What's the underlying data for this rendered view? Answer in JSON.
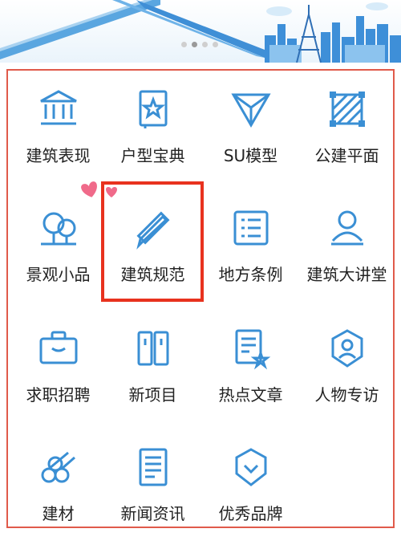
{
  "banner": {
    "pages": 4,
    "active_page": 1
  },
  "grid": [
    {
      "label": "建筑表现",
      "icon": "bank-icon"
    },
    {
      "label": "户型宝典",
      "icon": "star-book-icon"
    },
    {
      "label": "SU模型",
      "icon": "triangle-model-icon"
    },
    {
      "label": "公建平面",
      "icon": "hatched-square-icon"
    },
    {
      "label": "景观小品",
      "icon": "trees-icon"
    },
    {
      "label": "建筑规范",
      "icon": "ruler-pencil-icon"
    },
    {
      "label": "地方条例",
      "icon": "list-icon"
    },
    {
      "label": "建筑大讲堂",
      "icon": "person-icon"
    },
    {
      "label": "求职招聘",
      "icon": "briefcase-icon"
    },
    {
      "label": "新项目",
      "icon": "binders-icon"
    },
    {
      "label": "热点文章",
      "icon": "doc-star-icon"
    },
    {
      "label": "人物专访",
      "icon": "id-badge-icon"
    },
    {
      "label": "建材",
      "icon": "logs-icon"
    },
    {
      "label": "新闻资讯",
      "icon": "news-icon"
    },
    {
      "label": "优秀品牌",
      "icon": "brand-shield-icon"
    }
  ],
  "colors": {
    "icon": "#3a8fd4",
    "highlight": "#e8321e",
    "panel_border": "#e05a4a",
    "heart": "#f06a8a"
  }
}
